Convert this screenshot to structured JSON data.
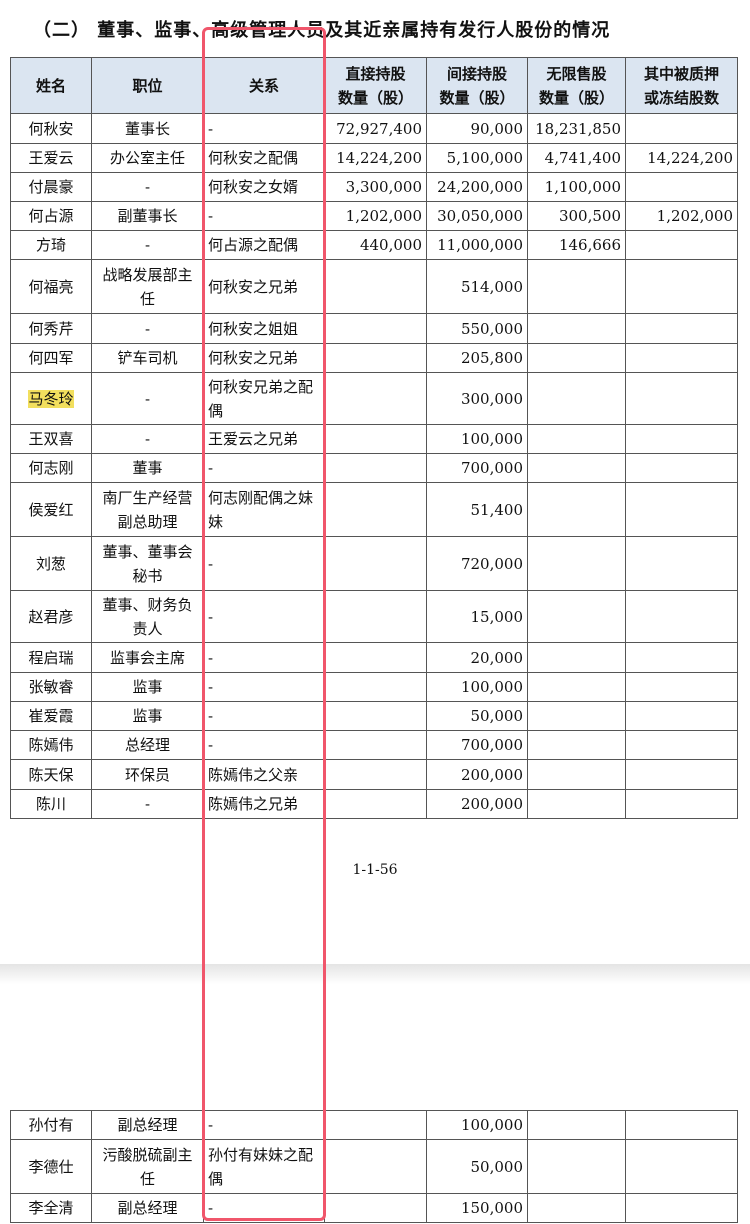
{
  "heading": "（二） 董事、监事、高级管理人员及其近亲属持有发行人股份的情况",
  "headers": [
    "姓名",
    "职位",
    "关系",
    "直接持股\n数量（股）",
    "间接持股\n数量（股）",
    "无限售股\n数量（股）",
    "其中被质押\n或冻结股数"
  ],
  "rows": [
    {
      "name": "何秋安",
      "position": "董事长",
      "relation": "-",
      "direct": "72,927,400",
      "indirect": "90,000",
      "unrestricted": "18,231,850",
      "pledged": ""
    },
    {
      "name": "王爱云",
      "position": "办公室主任",
      "relation": "何秋安之配偶",
      "direct": "14,224,200",
      "indirect": "5,100,000",
      "unrestricted": "4,741,400",
      "pledged": "14,224,200"
    },
    {
      "name": "付晨豪",
      "position": "-",
      "relation": "何秋安之女婿",
      "direct": "3,300,000",
      "indirect": "24,200,000",
      "unrestricted": "1,100,000",
      "pledged": ""
    },
    {
      "name": "何占源",
      "position": "副董事长",
      "relation": "-",
      "direct": "1,202,000",
      "indirect": "30,050,000",
      "unrestricted": "300,500",
      "pledged": "1,202,000"
    },
    {
      "name": "方琦",
      "position": "-",
      "relation": "何占源之配偶",
      "direct": "440,000",
      "indirect": "11,000,000",
      "unrestricted": "146,666",
      "pledged": ""
    },
    {
      "name": "何福亮",
      "position": "战略发展部主任",
      "relation": "何秋安之兄弟",
      "direct": "",
      "indirect": "514,000",
      "unrestricted": "",
      "pledged": ""
    },
    {
      "name": "何秀芹",
      "position": "-",
      "relation": "何秋安之姐姐",
      "direct": "",
      "indirect": "550,000",
      "unrestricted": "",
      "pledged": ""
    },
    {
      "name": "何四军",
      "position": "铲车司机",
      "relation": "何秋安之兄弟",
      "direct": "",
      "indirect": "205,800",
      "unrestricted": "",
      "pledged": ""
    },
    {
      "name": "马冬玲",
      "position": "-",
      "relation": "何秋安兄弟之配偶",
      "direct": "",
      "indirect": "300,000",
      "unrestricted": "",
      "pledged": ""
    },
    {
      "name": "王双喜",
      "position": "-",
      "relation": "王爱云之兄弟",
      "direct": "",
      "indirect": "100,000",
      "unrestricted": "",
      "pledged": ""
    },
    {
      "name": "何志刚",
      "position": "董事",
      "relation": "-",
      "direct": "",
      "indirect": "700,000",
      "unrestricted": "",
      "pledged": ""
    },
    {
      "name": "侯爱红",
      "position": "南厂生产经营副总助理",
      "relation": "何志刚配偶之妹妹",
      "direct": "",
      "indirect": "51,400",
      "unrestricted": "",
      "pledged": ""
    },
    {
      "name": "刘葱",
      "position": "董事、董事会秘书",
      "relation": "-",
      "direct": "",
      "indirect": "720,000",
      "unrestricted": "",
      "pledged": ""
    },
    {
      "name": "赵君彦",
      "position": "董事、财务负责人",
      "relation": "-",
      "direct": "",
      "indirect": "15,000",
      "unrestricted": "",
      "pledged": ""
    },
    {
      "name": "程启瑞",
      "position": "监事会主席",
      "relation": "-",
      "direct": "",
      "indirect": "20,000",
      "unrestricted": "",
      "pledged": ""
    },
    {
      "name": "张敏睿",
      "position": "监事",
      "relation": "-",
      "direct": "",
      "indirect": "100,000",
      "unrestricted": "",
      "pledged": ""
    },
    {
      "name": "崔爱霞",
      "position": "监事",
      "relation": "-",
      "direct": "",
      "indirect": "50,000",
      "unrestricted": "",
      "pledged": ""
    },
    {
      "name": "陈嫣伟",
      "position": "总经理",
      "relation": "-",
      "direct": "",
      "indirect": "700,000",
      "unrestricted": "",
      "pledged": ""
    },
    {
      "name": "陈天保",
      "position": "环保员",
      "relation": "陈嫣伟之父亲",
      "direct": "",
      "indirect": "200,000",
      "unrestricted": "",
      "pledged": ""
    },
    {
      "name": "陈川",
      "position": "-",
      "relation": "陈嫣伟之兄弟",
      "direct": "",
      "indirect": "200,000",
      "unrestricted": "",
      "pledged": ""
    }
  ],
  "page_number": "1-1-56",
  "rows_page2": [
    {
      "name": "孙付有",
      "position": "副总经理",
      "relation": "-",
      "direct": "",
      "indirect": "100,000",
      "unrestricted": "",
      "pledged": ""
    },
    {
      "name": "李德仕",
      "position": "污酸脱硫副主任",
      "relation": "孙付有妹妹之配偶",
      "direct": "",
      "indirect": "50,000",
      "unrestricted": "",
      "pledged": ""
    },
    {
      "name": "李全清",
      "position": "副总经理",
      "relation": "-",
      "direct": "",
      "indirect": "150,000",
      "unrestricted": "",
      "pledged": ""
    }
  ],
  "colors": {
    "header_bg": "#dbe5f1",
    "highlight": "#f2df5e",
    "annotation_box": "#f0566b"
  }
}
